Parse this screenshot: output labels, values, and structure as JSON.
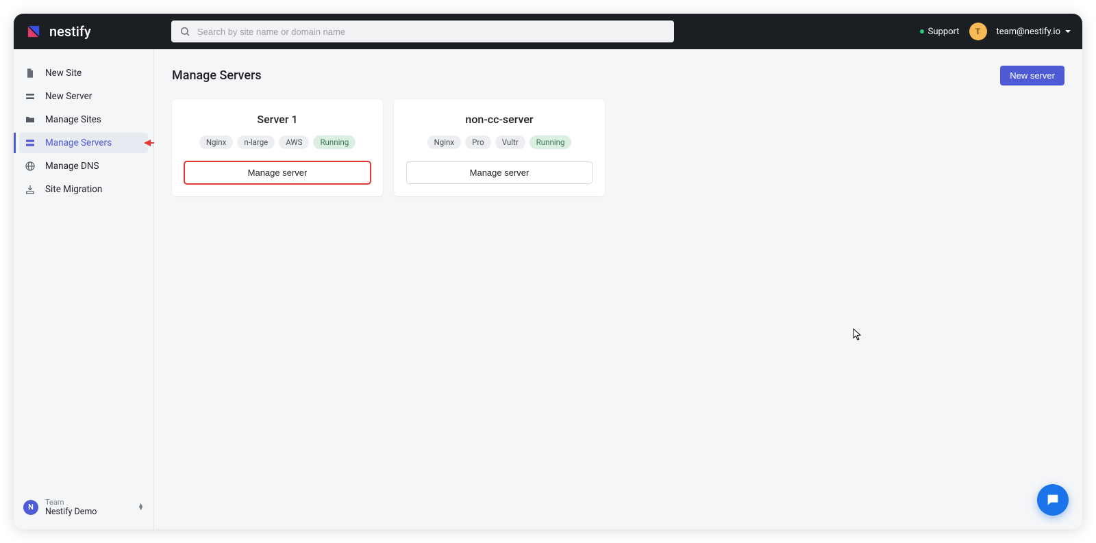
{
  "brand": {
    "name": "nestify"
  },
  "header": {
    "search_placeholder": "Search by site name or domain name",
    "support_label": "Support",
    "user_initial": "T",
    "user_email": "team@nestify.io"
  },
  "sidebar": {
    "items": [
      {
        "label": "New Site",
        "icon": "file"
      },
      {
        "label": "New Server",
        "icon": "server-stack"
      },
      {
        "label": "Manage Sites",
        "icon": "folder"
      },
      {
        "label": "Manage Servers",
        "icon": "servers",
        "active": true
      },
      {
        "label": "Manage DNS",
        "icon": "globe"
      },
      {
        "label": "Site Migration",
        "icon": "migration"
      }
    ],
    "team_label": "Team",
    "team_name": "Nestify Demo",
    "team_initial": "N"
  },
  "main": {
    "title": "Manage Servers",
    "new_server_label": "New server",
    "servers": [
      {
        "name": "Server 1",
        "tags": [
          "Nginx",
          "n-large",
          "AWS"
        ],
        "status": "Running",
        "manage_label": "Manage server",
        "highlight": true
      },
      {
        "name": "non-cc-server",
        "tags": [
          "Nginx",
          "Pro",
          "Vultr"
        ],
        "status": "Running",
        "manage_label": "Manage server",
        "highlight": false
      }
    ]
  }
}
